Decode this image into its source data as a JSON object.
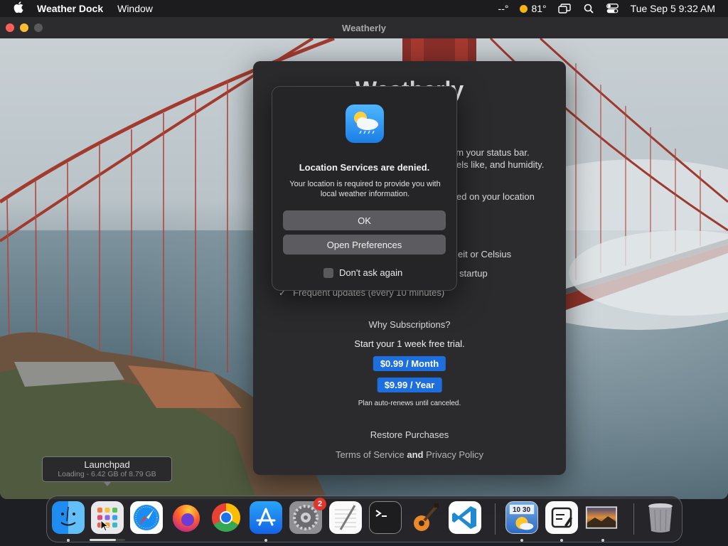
{
  "menubar": {
    "app_name": "Weather Dock",
    "menus": [
      "Window"
    ],
    "status_temp_placeholder": "--°",
    "weather_temp": "81°",
    "datetime": "Tue Sep 5  9:32 AM"
  },
  "window": {
    "title": "Weatherly"
  },
  "panel": {
    "title": "Weatherly",
    "feature_line_1": "om your status bar.",
    "feature_line_2": "els like, and humidity.",
    "feature_line_3": "ed on your location",
    "feature_line_4": "eit or Celsius",
    "feature_line_5": "startup",
    "feature_line_6": "Frequent updates (every 10 minutes)",
    "why_subscriptions": "Why Subscriptions?",
    "trial_text": "Start your 1 week free trial.",
    "monthly_price": "$0.99 / Month",
    "yearly_price": "$9.99 / Year",
    "renew_note": "Plan auto-renews until canceled.",
    "restore": "Restore Purchases",
    "terms": "Terms of Service",
    "and": "and",
    "privacy": "Privacy Policy"
  },
  "alert": {
    "title": "Location Services are denied.",
    "message": "Your location is required to provide you with local weather information.",
    "ok_label": "OK",
    "prefs_label": "Open Preferences",
    "dont_ask_label": "Don't ask again",
    "dont_ask_checked": false
  },
  "tooltip": {
    "title": "Launchpad",
    "subtitle": "Loading - 6.42 GB of 8.79 GB",
    "progress_fraction": 0.73
  },
  "dock": {
    "settings_badge": "2",
    "weather_clock": "10 30",
    "items": [
      "finder-icon",
      "launchpad-icon",
      "safari-icon",
      "firefox-icon",
      "chrome-icon",
      "app-store-icon",
      "system-settings-icon",
      "textedit-icon",
      "terminal-icon",
      "garageband-icon",
      "vscode-icon",
      "weather-dock-icon",
      "editor-icon",
      "photo-preview-icon",
      "trash-icon"
    ]
  }
}
